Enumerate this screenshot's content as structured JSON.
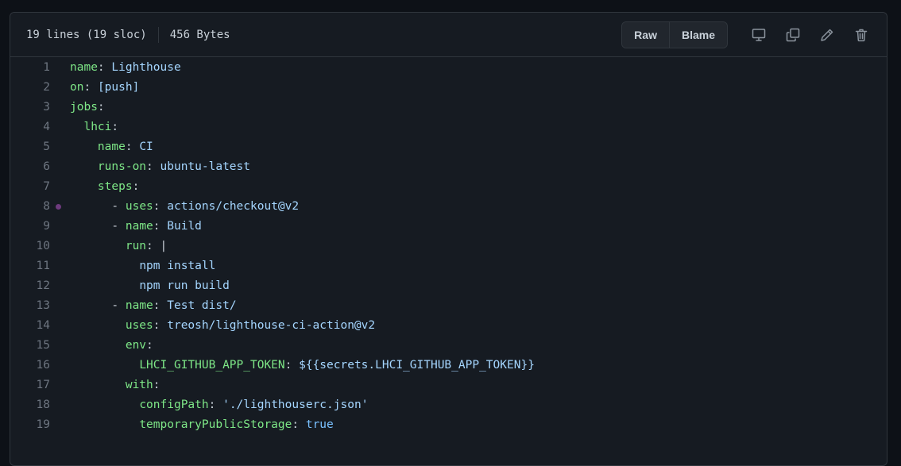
{
  "file_info": {
    "lines": "19 lines (19 sloc)",
    "size": "456 Bytes"
  },
  "toolbar": {
    "raw_label": "Raw",
    "blame_label": "Blame",
    "icons": [
      "desktop-icon",
      "copy-icon",
      "pencil-icon",
      "trash-icon"
    ]
  },
  "colors": {
    "key": "#7ee787",
    "value": "#a5d6ff",
    "constant": "#79c0ff",
    "line_number": "#6e7681",
    "marker": "#6e3b7e"
  },
  "code_lines": [
    {
      "n": "1",
      "indent": "",
      "dash": "",
      "key": "name",
      "sep": ": ",
      "val": "Lighthouse",
      "vtype": "v"
    },
    {
      "n": "2",
      "indent": "",
      "dash": "",
      "key": "on",
      "sep": ": ",
      "val": "[push]",
      "vtype": "v"
    },
    {
      "n": "3",
      "indent": "",
      "dash": "",
      "key": "jobs",
      "sep": ":",
      "val": "",
      "vtype": "v"
    },
    {
      "n": "4",
      "indent": "  ",
      "dash": "",
      "key": "lhci",
      "sep": ":",
      "val": "",
      "vtype": "v"
    },
    {
      "n": "5",
      "indent": "    ",
      "dash": "",
      "key": "name",
      "sep": ": ",
      "val": "CI",
      "vtype": "v"
    },
    {
      "n": "6",
      "indent": "    ",
      "dash": "",
      "key": "runs-on",
      "sep": ": ",
      "val": "ubuntu-latest",
      "vtype": "v"
    },
    {
      "n": "7",
      "indent": "    ",
      "dash": "",
      "key": "steps",
      "sep": ":",
      "val": "",
      "vtype": "v"
    },
    {
      "n": "8",
      "indent": "      ",
      "dash": "- ",
      "key": "uses",
      "sep": ": ",
      "val": "actions/checkout@v2",
      "vtype": "v",
      "marker": true
    },
    {
      "n": "9",
      "indent": "      ",
      "dash": "- ",
      "key": "name",
      "sep": ": ",
      "val": "Build",
      "vtype": "v"
    },
    {
      "n": "10",
      "indent": "        ",
      "dash": "",
      "key": "run",
      "sep": ": ",
      "val": "|",
      "vtype": "p"
    },
    {
      "n": "11",
      "indent": "          ",
      "dash": "",
      "key": "",
      "sep": "",
      "val": "npm install",
      "vtype": "v"
    },
    {
      "n": "12",
      "indent": "          ",
      "dash": "",
      "key": "",
      "sep": "",
      "val": "npm run build",
      "vtype": "v"
    },
    {
      "n": "13",
      "indent": "      ",
      "dash": "- ",
      "key": "name",
      "sep": ": ",
      "val": "Test dist/",
      "vtype": "v"
    },
    {
      "n": "14",
      "indent": "        ",
      "dash": "",
      "key": "uses",
      "sep": ": ",
      "val": "treosh/lighthouse-ci-action@v2",
      "vtype": "v"
    },
    {
      "n": "15",
      "indent": "        ",
      "dash": "",
      "key": "env",
      "sep": ":",
      "val": "",
      "vtype": "v"
    },
    {
      "n": "16",
      "indent": "          ",
      "dash": "",
      "key": "LHCI_GITHUB_APP_TOKEN",
      "sep": ": ",
      "val": "${{secrets.LHCI_GITHUB_APP_TOKEN}}",
      "vtype": "v"
    },
    {
      "n": "17",
      "indent": "        ",
      "dash": "",
      "key": "with",
      "sep": ":",
      "val": "",
      "vtype": "v"
    },
    {
      "n": "18",
      "indent": "          ",
      "dash": "",
      "key": "configPath",
      "sep": ": ",
      "val": "'./lighthouserc.json'",
      "vtype": "v"
    },
    {
      "n": "19",
      "indent": "          ",
      "dash": "",
      "key": "temporaryPublicStorage",
      "sep": ": ",
      "val": "true",
      "vtype": "c"
    }
  ]
}
